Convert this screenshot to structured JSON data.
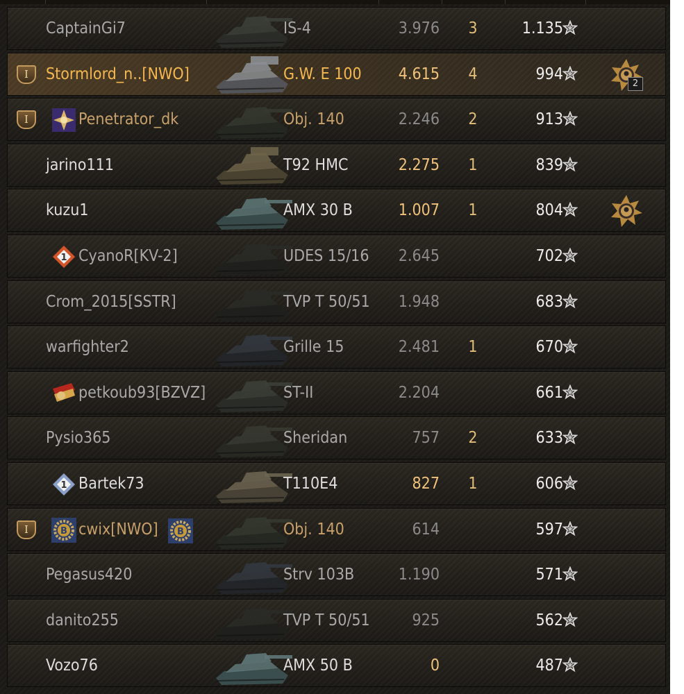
{
  "colors": {
    "name_default": "#a9a9a9",
    "name_bright": "#dedede",
    "name_platoon": "#c8a16a",
    "name_self": "#f5b850",
    "dmg_dim": "#8b8b8b",
    "dmg_gold": "#f0c27a",
    "kills": "#e3be7b",
    "xp": "#ececec"
  },
  "rows": [
    {
      "player": "CaptainGi7",
      "vehicle": "IS-4",
      "damage": "3.976",
      "kills": "3",
      "xp": "1.135",
      "name_style": "default",
      "vehicle_style": "default",
      "damage_style": "dim",
      "platoon": false,
      "badge": null,
      "medal": false,
      "medal_count": "",
      "clan_badge": false,
      "tank": "heavy"
    },
    {
      "player": "Stormlord_n..[NWO]",
      "vehicle": "G.W. E 100",
      "damage": "4.615",
      "kills": "4",
      "xp": "994",
      "name_style": "self",
      "vehicle_style": "self",
      "damage_style": "gold",
      "platoon": true,
      "platoon_label": "I",
      "badge": null,
      "medal": true,
      "medal_count": "2",
      "clan_badge": false,
      "self": true,
      "tank": "spg"
    },
    {
      "player": "Penetrator_dk",
      "vehicle": "Obj. 140",
      "damage": "2.246",
      "kills": "2",
      "xp": "913",
      "name_style": "platoon",
      "vehicle_style": "platoon",
      "damage_style": "dim",
      "platoon": true,
      "platoon_label": "I",
      "badge": "marks-purple-icon",
      "medal": false,
      "medal_count": "",
      "clan_badge": false,
      "tank": "medium"
    },
    {
      "player": "jarino111",
      "vehicle": "T92 HMC",
      "damage": "2.275",
      "kills": "1",
      "xp": "839",
      "name_style": "bright",
      "vehicle_style": "bright",
      "damage_style": "gold",
      "platoon": false,
      "badge": null,
      "medal": false,
      "medal_count": "",
      "clan_badge": false,
      "tank": "spg-tan"
    },
    {
      "player": "kuzu1",
      "vehicle": "AMX 30 B",
      "damage": "1.007",
      "kills": "1",
      "xp": "804",
      "name_style": "bright",
      "vehicle_style": "bright",
      "damage_style": "gold",
      "platoon": false,
      "badge": null,
      "medal": true,
      "medal_count": "",
      "clan_badge": false,
      "tank": "medium-teal"
    },
    {
      "player": "CyanoR[KV-2]",
      "vehicle": "UDES 15/16",
      "damage": "2.645",
      "kills": "",
      "xp": "702",
      "name_style": "default",
      "vehicle_style": "default",
      "damage_style": "dim",
      "platoon": false,
      "badge": "diamond-1-icon",
      "medal": false,
      "medal_count": "",
      "clan_badge": false,
      "tank": "dark"
    },
    {
      "player": "Crom_2015[SSTR]",
      "vehicle": "TVP T 50/51",
      "damage": "1.948",
      "kills": "",
      "xp": "683",
      "name_style": "default",
      "vehicle_style": "default",
      "damage_style": "dim",
      "platoon": false,
      "badge": null,
      "medal": false,
      "medal_count": "",
      "clan_badge": false,
      "tank": "dark"
    },
    {
      "player": "warfighter2",
      "vehicle": "Grille 15",
      "damage": "2.481",
      "kills": "1",
      "xp": "670",
      "name_style": "default",
      "vehicle_style": "default",
      "damage_style": "dim",
      "platoon": false,
      "badge": null,
      "medal": false,
      "medal_count": "",
      "clan_badge": false,
      "tank": "td"
    },
    {
      "player": "petkoub93[BZVZ]",
      "vehicle": "ST-II",
      "damage": "2.204",
      "kills": "",
      "xp": "661",
      "name_style": "default",
      "vehicle_style": "default",
      "damage_style": "dim",
      "platoon": false,
      "badge": "flag-red-icon",
      "medal": false,
      "medal_count": "",
      "clan_badge": false,
      "tank": "heavy"
    },
    {
      "player": "Pysio365",
      "vehicle": "Sheridan",
      "damage": "757",
      "kills": "2",
      "xp": "633",
      "name_style": "default",
      "vehicle_style": "default",
      "damage_style": "dim",
      "platoon": false,
      "badge": null,
      "medal": false,
      "medal_count": "",
      "clan_badge": false,
      "tank": "light"
    },
    {
      "player": "Bartek73",
      "vehicle": "T110E4",
      "damage": "827",
      "kills": "1",
      "xp": "606",
      "name_style": "bright",
      "vehicle_style": "bright",
      "damage_style": "gold",
      "platoon": false,
      "badge": "diamond-1-blue-icon",
      "medal": false,
      "medal_count": "",
      "clan_badge": false,
      "tank": "td-tan"
    },
    {
      "player": "cwix[NWO]",
      "vehicle": "Obj. 140",
      "damage": "614",
      "kills": "",
      "xp": "597",
      "name_style": "platoon",
      "vehicle_style": "platoon",
      "damage_style": "dim",
      "platoon": true,
      "platoon_label": "I",
      "badge": "b-gear-icon",
      "medal": false,
      "medal_count": "",
      "clan_badge": true,
      "tank": "medium"
    },
    {
      "player": "Pegasus420",
      "vehicle": "Strv 103B",
      "damage": "1.190",
      "kills": "",
      "xp": "571",
      "name_style": "default",
      "vehicle_style": "default",
      "damage_style": "dim",
      "platoon": false,
      "badge": null,
      "medal": false,
      "medal_count": "",
      "clan_badge": false,
      "tank": "td"
    },
    {
      "player": "danito255",
      "vehicle": "TVP T 50/51",
      "damage": "925",
      "kills": "",
      "xp": "562",
      "name_style": "default",
      "vehicle_style": "default",
      "damage_style": "dim",
      "platoon": false,
      "badge": null,
      "medal": false,
      "medal_count": "",
      "clan_badge": false,
      "tank": "dark"
    },
    {
      "player": "Vozo76",
      "vehicle": "AMX 50 B",
      "damage": "0",
      "kills": "",
      "xp": "487",
      "name_style": "bright",
      "vehicle_style": "bright",
      "damage_style": "gold",
      "platoon": false,
      "badge": null,
      "medal": false,
      "medal_count": "",
      "clan_badge": false,
      "tank": "heavy-teal"
    }
  ]
}
